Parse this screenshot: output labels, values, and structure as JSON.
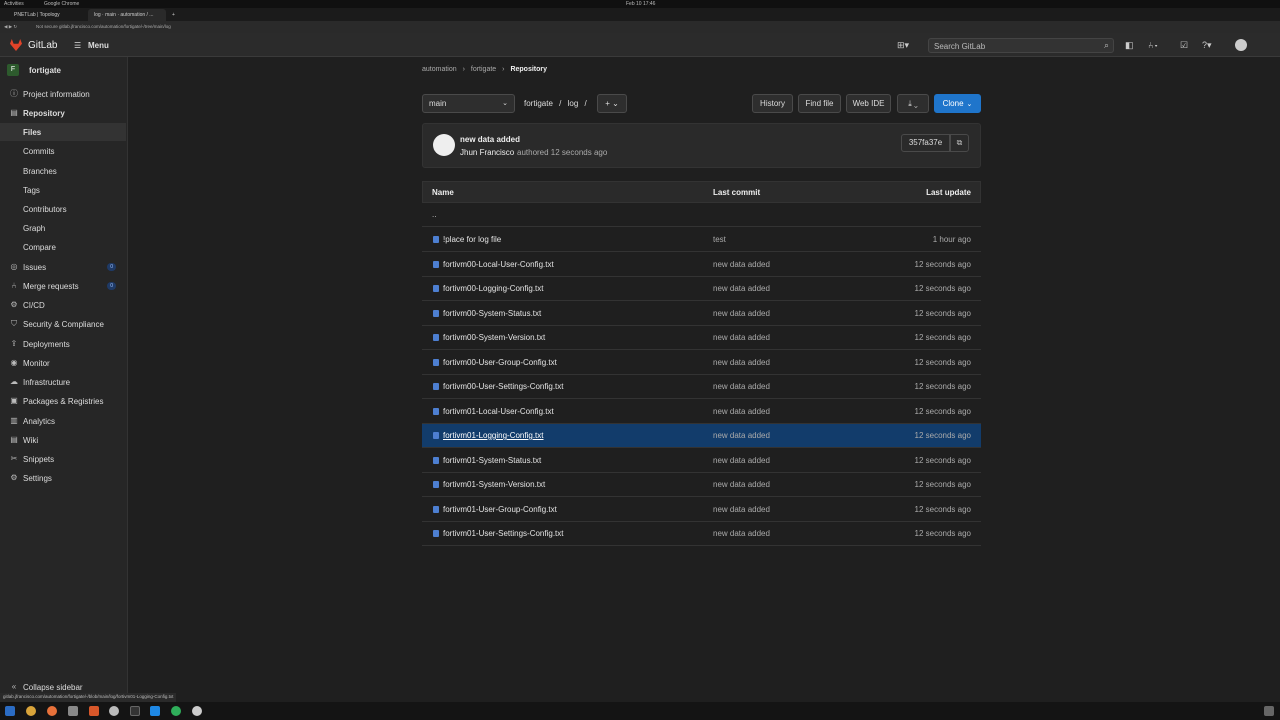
{
  "os": {
    "activities": "Activities",
    "app": "Google Chrome",
    "clock": "Feb 10  17:46"
  },
  "browser": {
    "tabs": [
      {
        "label": "PNETLab | Topology"
      },
      {
        "label": "log · main · automation / ..."
      }
    ],
    "address": "Not secure  gitlab.jfrancisco.com/automation/fortigate/-/tree/main/log",
    "status_url": "gitlab.jfrancisco.com/automation/fortigate/-/blob/main/log/fortivm01-Logging-Config.txt"
  },
  "topbar": {
    "logo": "GitLab",
    "menu": "Menu",
    "search_placeholder": "Search GitLab"
  },
  "sidebar": {
    "project_initial": "F",
    "project_name": "fortigate",
    "items": [
      {
        "label": "Project information",
        "icon": "info-icon"
      },
      {
        "label": "Repository",
        "icon": "book-icon"
      },
      {
        "label": "Files"
      },
      {
        "label": "Commits"
      },
      {
        "label": "Branches"
      },
      {
        "label": "Tags"
      },
      {
        "label": "Contributors"
      },
      {
        "label": "Graph"
      },
      {
        "label": "Compare"
      },
      {
        "label": "Issues",
        "badge": "0",
        "icon": "issues-icon"
      },
      {
        "label": "Merge requests",
        "badge": "0",
        "icon": "merge-icon"
      },
      {
        "label": "CI/CD",
        "icon": "rocket-icon"
      },
      {
        "label": "Security & Compliance",
        "icon": "shield-icon"
      },
      {
        "label": "Deployments",
        "icon": "deploy-icon"
      },
      {
        "label": "Monitor",
        "icon": "monitor-icon"
      },
      {
        "label": "Infrastructure",
        "icon": "cloud-icon"
      },
      {
        "label": "Packages & Registries",
        "icon": "package-icon"
      },
      {
        "label": "Analytics",
        "icon": "chart-icon"
      },
      {
        "label": "Wiki",
        "icon": "book-icon"
      },
      {
        "label": "Snippets",
        "icon": "scissors-icon"
      },
      {
        "label": "Settings",
        "icon": "gear-icon"
      }
    ],
    "collapse": "Collapse sidebar"
  },
  "breadcrumb": {
    "parts": [
      "automation",
      "fortigate",
      "Repository"
    ]
  },
  "toolbar": {
    "branch": "main",
    "path": [
      "fortigate",
      "log"
    ],
    "history": "History",
    "find_file": "Find file",
    "web_ide": "Web IDE",
    "clone": "Clone"
  },
  "commit": {
    "title": "new data added",
    "author": "Jhun Francisco",
    "meta": "authored 12 seconds ago",
    "sha": "357fa37e"
  },
  "table": {
    "headers": [
      "Name",
      "Last commit",
      "Last update"
    ],
    "parent": "..",
    "rows": [
      {
        "name": "!place for log file",
        "commit": "test",
        "update": "1 hour ago"
      },
      {
        "name": "fortivm00-Local-User-Config.txt",
        "commit": "new data added",
        "update": "12 seconds ago"
      },
      {
        "name": "fortivm00-Logging-Config.txt",
        "commit": "new data added",
        "update": "12 seconds ago"
      },
      {
        "name": "fortivm00-System-Status.txt",
        "commit": "new data added",
        "update": "12 seconds ago"
      },
      {
        "name": "fortivm00-System-Version.txt",
        "commit": "new data added",
        "update": "12 seconds ago"
      },
      {
        "name": "fortivm00-User-Group-Config.txt",
        "commit": "new data added",
        "update": "12 seconds ago"
      },
      {
        "name": "fortivm00-User-Settings-Config.txt",
        "commit": "new data added",
        "update": "12 seconds ago"
      },
      {
        "name": "fortivm01-Local-User-Config.txt",
        "commit": "new data added",
        "update": "12 seconds ago"
      },
      {
        "name": "fortivm01-Logging-Config.txt",
        "commit": "new data added",
        "update": "12 seconds ago"
      },
      {
        "name": "fortivm01-System-Status.txt",
        "commit": "new data added",
        "update": "12 seconds ago"
      },
      {
        "name": "fortivm01-System-Version.txt",
        "commit": "new data added",
        "update": "12 seconds ago"
      },
      {
        "name": "fortivm01-User-Group-Config.txt",
        "commit": "new data added",
        "update": "12 seconds ago"
      },
      {
        "name": "fortivm01-User-Settings-Config.txt",
        "commit": "new data added",
        "update": "12 seconds ago"
      }
    ]
  },
  "colors": {
    "accent": "#1f75cb",
    "selected_row": "#123c6b",
    "gitlab_orange": "#e24329"
  }
}
